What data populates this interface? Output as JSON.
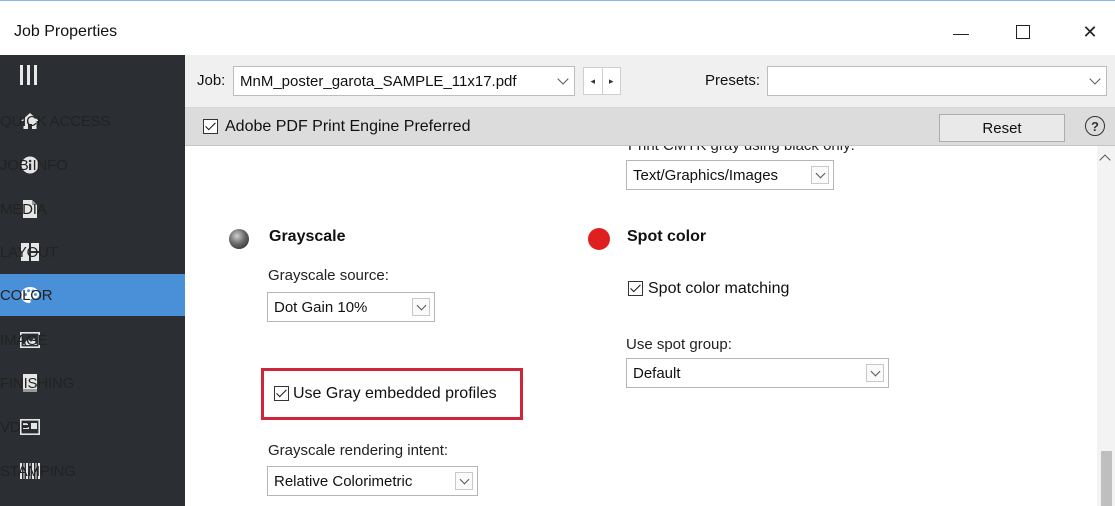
{
  "window": {
    "title": "Job Properties",
    "controls": {
      "minimize": "minimize",
      "maximize": "maximize",
      "close": "✕"
    }
  },
  "sidebar": {
    "items": [
      {
        "label": "QUICK ACCESS",
        "icon": "home-icon",
        "active": false
      },
      {
        "label": "JOB INFO",
        "icon": "info-icon",
        "active": false
      },
      {
        "label": "MEDIA",
        "icon": "document-icon",
        "active": false
      },
      {
        "label": "LAYOUT",
        "icon": "layout-icon",
        "active": false
      },
      {
        "label": "COLOR",
        "icon": "palette-icon",
        "active": true
      },
      {
        "label": "IMAGE",
        "icon": "image-icon",
        "active": false
      },
      {
        "label": "FINISHING",
        "icon": "book-icon",
        "active": false
      },
      {
        "label": "VDP",
        "icon": "vdp-icon",
        "active": false
      },
      {
        "label": "STAMPING",
        "icon": "barcode-icon",
        "active": false
      }
    ]
  },
  "jobbar": {
    "job_label": "Job:",
    "job_value": "MnM_poster_garota_SAMPLE_11x17.pdf",
    "presets_label": "Presets:",
    "presets_value": ""
  },
  "enginebar": {
    "engine_label": "Adobe PDF Print Engine Preferred",
    "engine_checked": true,
    "reset_label": "Reset"
  },
  "content": {
    "cmyk_label_clipped": "Print CMYK gray using black only:",
    "cmyk_value": "Text/Graphics/Images",
    "grayscale": {
      "title": "Grayscale",
      "source_label": "Grayscale source:",
      "source_value": "Dot Gain 10%",
      "embedded_label": "Use Gray embedded profiles",
      "embedded_checked": true,
      "intent_label": "Grayscale rendering intent:",
      "intent_value": "Relative Colorimetric"
    },
    "spot": {
      "title": "Spot color",
      "matching_label": "Spot color matching",
      "matching_checked": true,
      "group_label": "Use spot group:",
      "group_value": "Default"
    }
  },
  "colors": {
    "sidebar_bg": "#2b2f33",
    "sidebar_active": "#4a90d9",
    "highlight": "#d0243a",
    "spot_dot": "#e02020"
  }
}
